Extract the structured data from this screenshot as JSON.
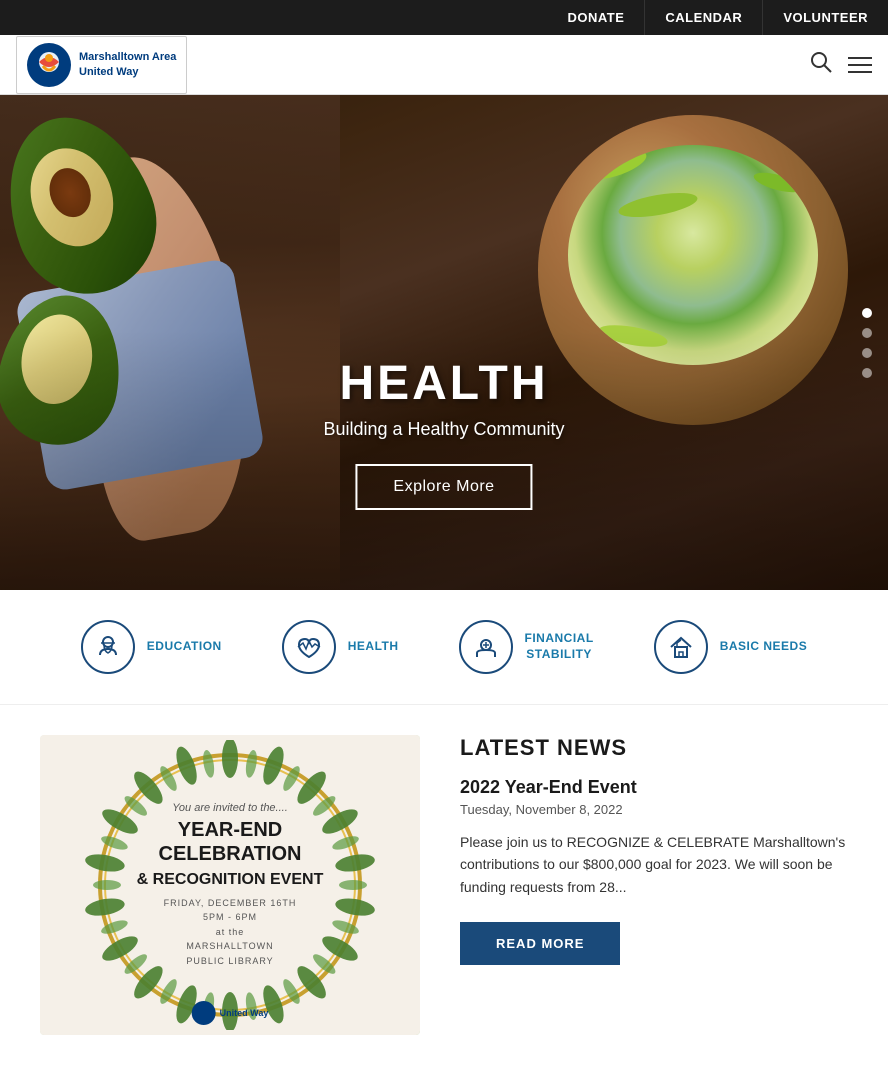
{
  "topnav": {
    "items": [
      {
        "label": "DONATE",
        "id": "donate"
      },
      {
        "label": "CALENDAR",
        "id": "calendar"
      },
      {
        "label": "VOLUNTEER",
        "id": "volunteer"
      }
    ]
  },
  "header": {
    "logo_org": "United Way",
    "logo_area": "Marshalltown Area",
    "logo_sub": "United Way"
  },
  "hero": {
    "title": "HEALTH",
    "subtitle": "Building a Healthy Community",
    "cta": "Explore More",
    "slides": 4
  },
  "categories": [
    {
      "label": "EDUCATION",
      "icon": "🎓"
    },
    {
      "label": "HEALTH",
      "icon": "🫀"
    },
    {
      "label": "FINANCIAL\nSTABILITY",
      "icon": "🏠"
    },
    {
      "label": "BASIC NEEDS",
      "icon": "🏡"
    }
  ],
  "news": {
    "section_title": "LATEST NEWS",
    "article": {
      "title": "2022 Year-End Event",
      "date": "Tuesday, November 8, 2022",
      "excerpt": "Please join us to RECOGNIZE & CELEBRATE Marshalltown's contributions to our $800,000 goal for 2023. We will soon be funding requests from 28...",
      "read_more": "READ MORE"
    }
  },
  "event_card": {
    "invite_text": "You are invited to the....",
    "title_line1": "YEAR-END",
    "title_line2": "CELEBRATION",
    "title_line3": "& RECOGNITION EVENT",
    "detail_day": "FRIDAY, DECEMBER 16TH",
    "detail_time": "5PM - 6PM",
    "detail_at": "at the",
    "detail_venue_line1": "MARSHALLTOWN",
    "detail_venue_line2": "PUBLIC LIBRARY",
    "logo_text": "United Way"
  }
}
